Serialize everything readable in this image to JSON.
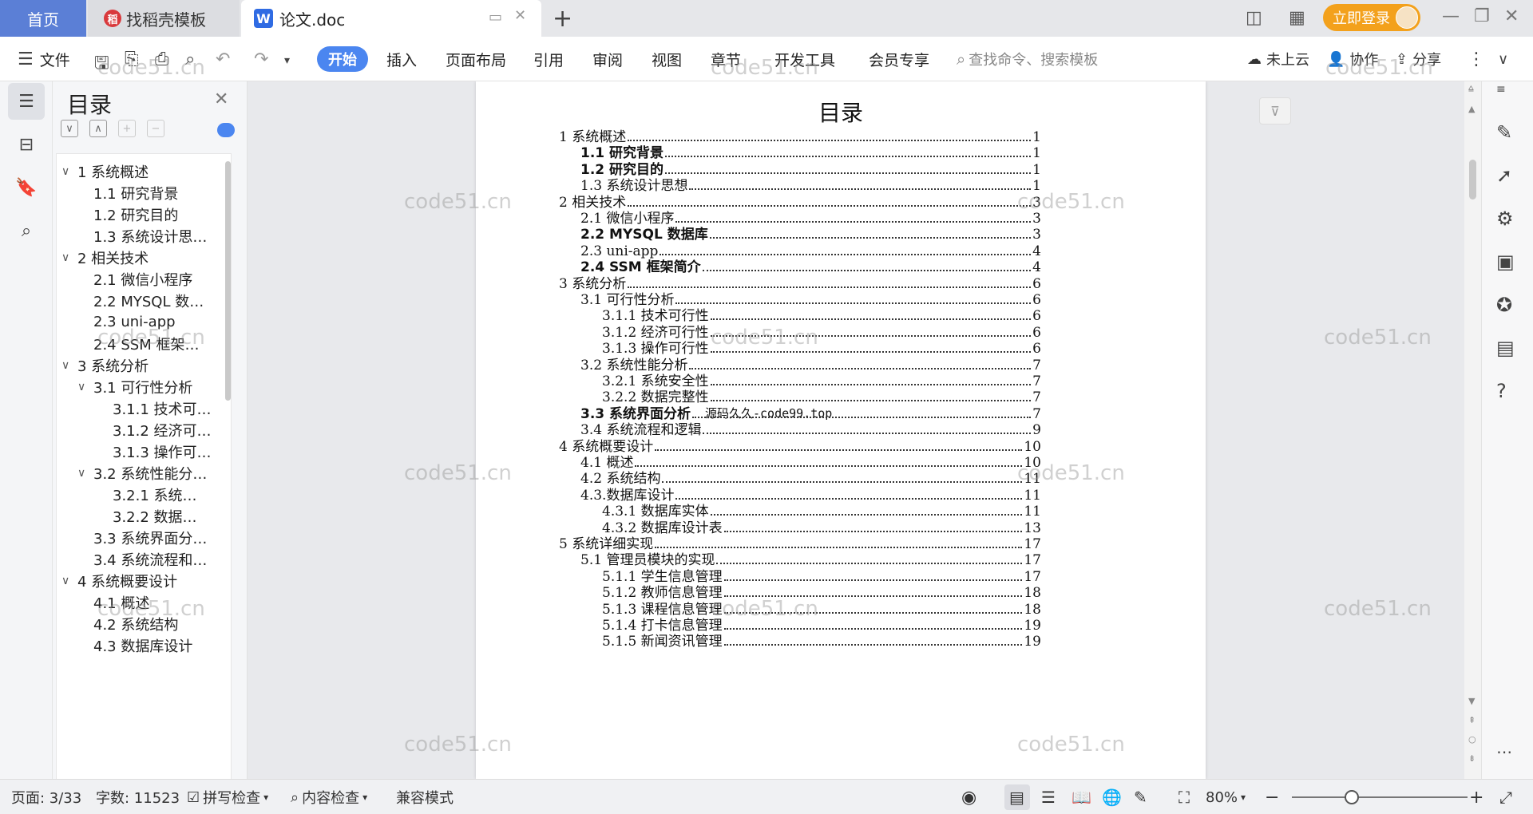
{
  "tabs": {
    "home": "首页",
    "docer": "找稻壳模板",
    "document": "论文.doc",
    "add": "+"
  },
  "titlebar": {
    "login": "立即登录"
  },
  "ribbon": {
    "file": "文件",
    "menus": [
      "开始",
      "插入",
      "页面布局",
      "引用",
      "审阅",
      "视图",
      "章节",
      "开发工具",
      "会员专享"
    ],
    "search_placeholder": "查找命令、搜索模板",
    "cloud": "未上云",
    "collab": "协作",
    "share": "分享"
  },
  "toc_panel": {
    "title": "目录",
    "items": [
      {
        "label": "1 系统概述",
        "level": 1,
        "expandable": true
      },
      {
        "label": "1.1  研究背景",
        "level": 2,
        "expandable": false
      },
      {
        "label": "1.2 研究目的",
        "level": 2,
        "expandable": false
      },
      {
        "label": "1.3 系统设计思…",
        "level": 2,
        "expandable": false
      },
      {
        "label": "2 相关技术",
        "level": 1,
        "expandable": true
      },
      {
        "label": "2.1 微信小程序",
        "level": 2,
        "expandable": false
      },
      {
        "label": "2.2 MYSQL 数…",
        "level": 2,
        "expandable": false
      },
      {
        "label": "2.3 uni-app",
        "level": 2,
        "expandable": false
      },
      {
        "label": "2.4 SSM 框架…",
        "level": 2,
        "expandable": false
      },
      {
        "label": "3 系统分析",
        "level": 1,
        "expandable": true
      },
      {
        "label": "3.1 可行性分析",
        "level": 2,
        "expandable": true
      },
      {
        "label": "3.1.1 技术可…",
        "level": 3,
        "expandable": false
      },
      {
        "label": "3.1.2 经济可…",
        "level": 3,
        "expandable": false
      },
      {
        "label": "3.1.3 操作可…",
        "level": 3,
        "expandable": false
      },
      {
        "label": "3.2 系统性能分…",
        "level": 2,
        "expandable": true
      },
      {
        "label": "3.2.1  系统…",
        "level": 3,
        "expandable": false
      },
      {
        "label": "3.2.2  数据…",
        "level": 3,
        "expandable": false
      },
      {
        "label": "3.3 系统界面分…",
        "level": 2,
        "expandable": false
      },
      {
        "label": "3.4 系统流程和…",
        "level": 2,
        "expandable": false
      },
      {
        "label": "4 系统概要设计",
        "level": 1,
        "expandable": true
      },
      {
        "label": "4.1 概述",
        "level": 2,
        "expandable": false
      },
      {
        "label": "4.2 系统结构",
        "level": 2,
        "expandable": false
      },
      {
        "label": "4.3 数据库设计",
        "level": 2,
        "expandable": false
      }
    ]
  },
  "document": {
    "title": "目录",
    "overlay": "源码久久-code99.top",
    "entries": [
      {
        "text": "1 系统概述",
        "page": "1",
        "level": 1,
        "sans": false
      },
      {
        "text": "1.1  研究背景",
        "page": "1",
        "level": 2,
        "sans": true
      },
      {
        "text": "1.2 研究目的",
        "page": "1",
        "level": 2,
        "sans": true
      },
      {
        "text": "1.3 系统设计思想",
        "page": "1",
        "level": 2,
        "sans": false
      },
      {
        "text": "2 相关技术",
        "page": "3",
        "level": 1,
        "sans": false
      },
      {
        "text": "2.1 微信小程序",
        "page": "3",
        "level": 2,
        "sans": false
      },
      {
        "text": "2.2 MYSQL 数据库",
        "page": "3",
        "level": 2,
        "sans": true
      },
      {
        "text": "2.3 uni-app",
        "page": "4",
        "level": 2,
        "sans": false
      },
      {
        "text": "2.4 SSM 框架简介",
        "page": "4",
        "level": 2,
        "sans": true
      },
      {
        "text": "3 系统分析",
        "page": "6",
        "level": 1,
        "sans": false
      },
      {
        "text": "3.1 可行性分析",
        "page": "6",
        "level": 2,
        "sans": false
      },
      {
        "text": "3.1.1 技术可行性",
        "page": "6",
        "level": 3,
        "sans": false
      },
      {
        "text": "3.1.2 经济可行性",
        "page": "6",
        "level": 3,
        "sans": false
      },
      {
        "text": "3.1.3 操作可行性",
        "page": "6",
        "level": 3,
        "sans": false
      },
      {
        "text": "3.2 系统性能分析",
        "page": "7",
        "level": 2,
        "sans": false
      },
      {
        "text": "3.2.1  系统安全性",
        "page": "7",
        "level": 3,
        "sans": false
      },
      {
        "text": "3.2.2  数据完整性",
        "page": "7",
        "level": 3,
        "sans": false
      },
      {
        "text": "3.3 系统界面分析",
        "page": "7",
        "level": 2,
        "sans": true
      },
      {
        "text": "3.4 系统流程和逻辑",
        "page": "9",
        "level": 2,
        "sans": false
      },
      {
        "text": "4 系统概要设计",
        "page": "10",
        "level": 1,
        "sans": false
      },
      {
        "text": "4.1 概述",
        "page": "10",
        "level": 2,
        "sans": false
      },
      {
        "text": "4.2 系统结构",
        "page": "11",
        "level": 2,
        "sans": false
      },
      {
        "text": "4.3.数据库设计",
        "page": "11",
        "level": 2,
        "sans": false
      },
      {
        "text": "4.3.1 数据库实体",
        "page": "11",
        "level": 3,
        "sans": false
      },
      {
        "text": "4.3.2 数据库设计表",
        "page": "13",
        "level": 3,
        "sans": false
      },
      {
        "text": "5 系统详细实现",
        "page": "17",
        "level": 1,
        "sans": false
      },
      {
        "text": "5.1  管理员模块的实现",
        "page": "17",
        "level": 2,
        "sans": false
      },
      {
        "text": "5.1.1  学生信息管理",
        "page": "17",
        "level": 3,
        "sans": false
      },
      {
        "text": "5.1.2  教师信息管理",
        "page": "18",
        "level": 3,
        "sans": false
      },
      {
        "text": "5.1.3  课程信息管理",
        "page": "18",
        "level": 3,
        "sans": false
      },
      {
        "text": "5.1.4  打卡信息管理",
        "page": "19",
        "level": 3,
        "sans": false
      },
      {
        "text": "5.1.5  新闻资讯管理",
        "page": "19",
        "level": 3,
        "sans": false
      }
    ]
  },
  "statusbar": {
    "page": "页面: 3/33",
    "words": "字数: 11523",
    "spellcheck": "拼写检查",
    "content_check": "内容检查",
    "compat": "兼容模式",
    "zoom": "80%",
    "zoom_level_percent": 80
  },
  "watermark": "code51.cn",
  "colors": {
    "home_tab": "#5b7fd6",
    "start_button": "#4b86f0",
    "login_button": "#f3a11c"
  }
}
